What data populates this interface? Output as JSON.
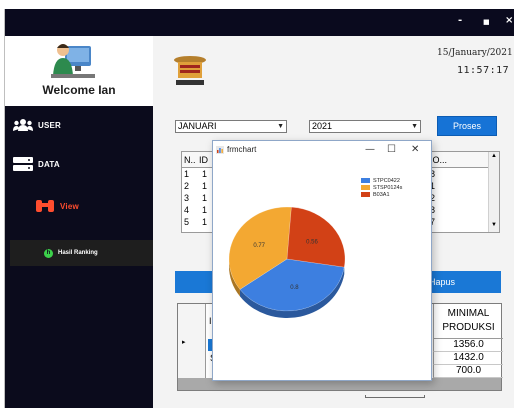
{
  "window": {
    "minimize": "-",
    "maximize": "■",
    "close": "×"
  },
  "sidebar": {
    "welcome": "Welcome Ian",
    "items": [
      {
        "label": "USER",
        "icon": "users-icon"
      },
      {
        "label": "DATA",
        "icon": "server-icon"
      },
      {
        "label": "View",
        "icon": "binoculars-icon"
      },
      {
        "label": "Hasil Ranking",
        "icon": "hasil-ranking-icon"
      }
    ]
  },
  "header": {
    "date": "15/January/2021",
    "time": "11:57:17"
  },
  "filters": {
    "month": "JANUARI",
    "year": "2021",
    "process_label": "Proses"
  },
  "grid1": {
    "col_n": "N..",
    "col_id": "ID",
    "col_no": "NO...",
    "rows": [
      {
        "n": "1",
        "id": "1",
        "no": "8"
      },
      {
        "n": "2",
        "id": "1",
        "no": "1"
      },
      {
        "n": "3",
        "id": "1",
        "no": "2"
      },
      {
        "n": "4",
        "id": "1",
        "no": "8"
      },
      {
        "n": "5",
        "id": "1",
        "no": "7"
      }
    ]
  },
  "action_bar": {
    "right_label": "Hapus"
  },
  "grid2": {
    "col_partial": "I",
    "header": "MINIMAL PRODUKSI",
    "header_line1": "MINIMAL",
    "header_line2": "PRODUKSI",
    "row_marker": "▸",
    "row2_partial": "S",
    "values": [
      "1356.0",
      "1432.0",
      "700.0"
    ]
  },
  "popup": {
    "title": "frmchart",
    "minimize": "—",
    "maximize": "☐",
    "close": "✕"
  },
  "chart_data": {
    "type": "pie",
    "title": "",
    "labels": [
      "STPC0422",
      "STSP0124s",
      "B03A1"
    ],
    "values": [
      0.8,
      0.77,
      0.56
    ],
    "colors": [
      "#3d7fe0",
      "#f3a832",
      "#d24116"
    ],
    "legend_position": "top-right"
  }
}
